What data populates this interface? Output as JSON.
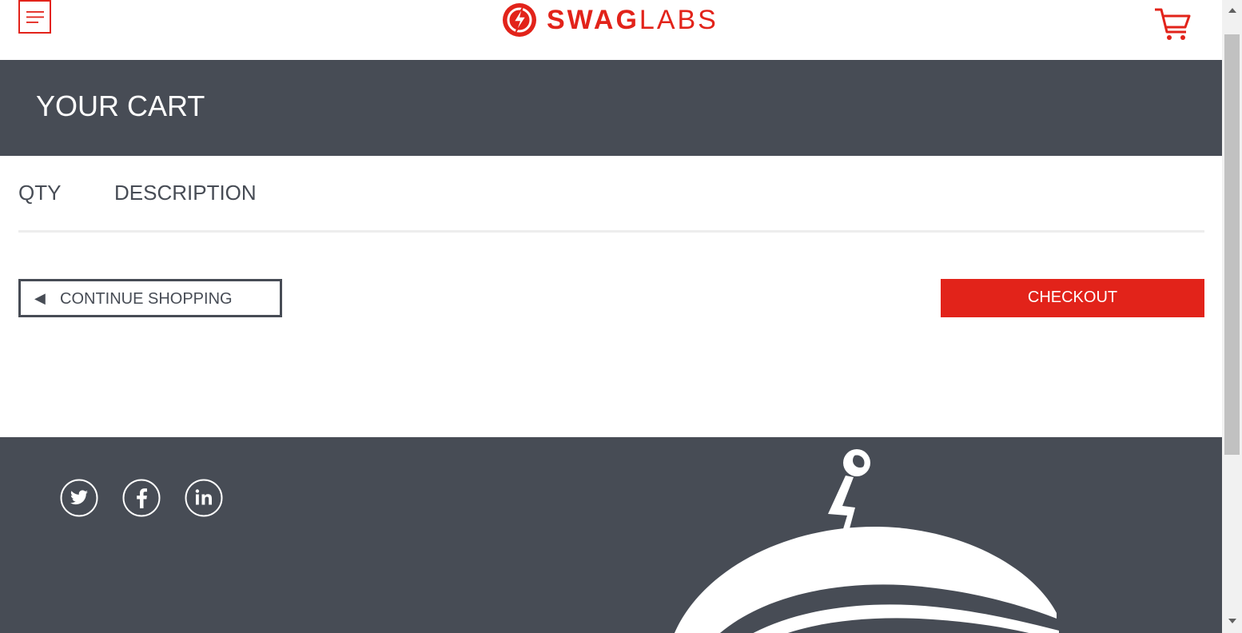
{
  "header": {
    "brand_bold": "SWAG",
    "brand_light": "LABS",
    "menu_icon": "hamburger-menu-icon",
    "cart_icon": "shopping-cart-icon"
  },
  "title_bar": {
    "title": "YOUR CART"
  },
  "cart_list": {
    "columns": [
      "QTY",
      "DESCRIPTION"
    ]
  },
  "actions": {
    "continue_arrow": "◀",
    "continue_label": "CONTINUE SHOPPING",
    "checkout_label": "CHECKOUT"
  },
  "footer": {
    "social_links": [
      "twitter-icon",
      "facebook-icon",
      "linkedin-icon"
    ]
  },
  "colors": {
    "accent": "#e2231a",
    "dark": "#474c55",
    "divider": "#ededed"
  }
}
